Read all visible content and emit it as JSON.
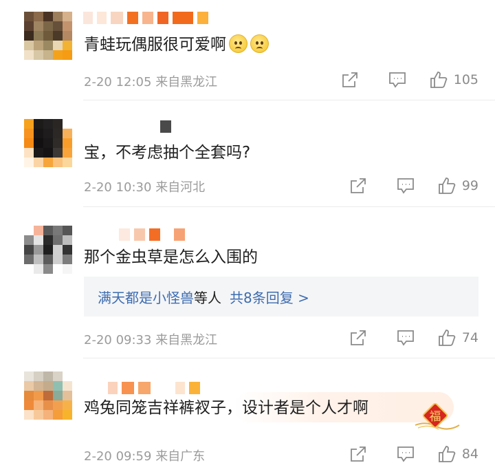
{
  "comments": [
    {
      "text": "青蛙玩偶服很可爱啊",
      "emoji": [
        "sad-face-emoji",
        "sad-face-emoji"
      ],
      "time": "2-20 12:05",
      "location": "来自黑龙江",
      "likes": "105"
    },
    {
      "text": "宝，不考虑抽个全套吗?",
      "time": "2-20 10:30",
      "location": "来自河北",
      "likes": "99"
    },
    {
      "text": "那个金虫草是怎么入围的",
      "reply_summary": {
        "replier": "满天都是小怪兽",
        "mid": "等人",
        "count_text": "共8条回复 >"
      },
      "time": "2-20 09:33",
      "location": "来自黑龙江",
      "likes": "74"
    },
    {
      "text": "鸡兔同笼吉祥裤衩子，设计者是个人才啊",
      "badge": "福",
      "time": "2-20 09:59",
      "location": "来自广东",
      "likes": "84"
    }
  ],
  "colors": {
    "link_blue": "#3d6cb0",
    "meta_gray": "#9b9b9b",
    "reply_bg": "#f4f5f7"
  }
}
